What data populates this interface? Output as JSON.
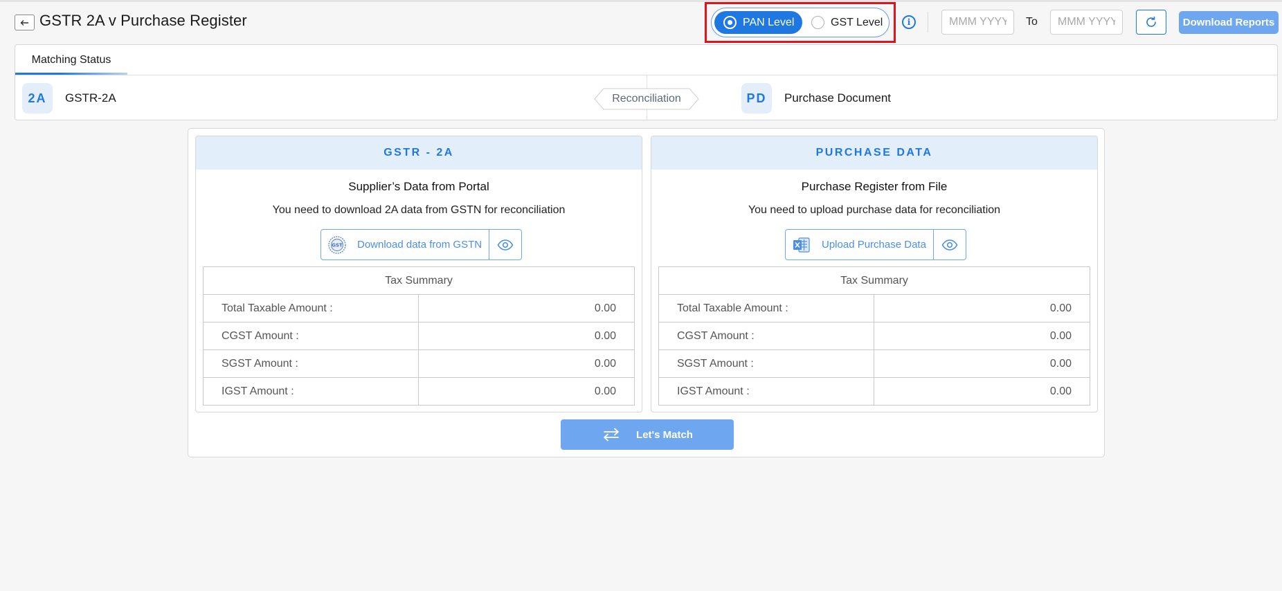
{
  "header": {
    "title": "GSTR 2A v Purchase Register",
    "level_options": [
      {
        "label": "PAN Level",
        "selected": true
      },
      {
        "label": "GST Level",
        "selected": false
      }
    ],
    "from_placeholder": "MMM YYYY",
    "to_label": "To",
    "to_placeholder": "MMM YYYY",
    "download_reports_label": "Download Reports"
  },
  "status": {
    "tab_label": "Matching Status",
    "left_badge": "2A",
    "left_label": "GSTR-2A",
    "center_label": "Reconciliation",
    "right_badge": "PD",
    "right_label": "Purchase Document"
  },
  "panels": [
    {
      "heading": "GSTR - 2A",
      "title": "Supplier’s Data from Portal",
      "description": "You need to download 2A data from GSTN for reconciliation",
      "action_label": "Download data from GSTN",
      "action_icon": "gst-seal-icon",
      "summary": {
        "heading": "Tax Summary",
        "rows": [
          {
            "label": "Total Taxable Amount :",
            "value": "0.00"
          },
          {
            "label": "CGST Amount :",
            "value": "0.00"
          },
          {
            "label": "SGST Amount :",
            "value": "0.00"
          },
          {
            "label": "IGST Amount :",
            "value": "0.00"
          }
        ]
      }
    },
    {
      "heading": "PURCHASE DATA",
      "title": "Purchase Register from File",
      "description": "You need to upload purchase data for reconciliation",
      "action_label": "Upload Purchase Data",
      "action_icon": "excel-file-icon",
      "summary": {
        "heading": "Tax Summary",
        "rows": [
          {
            "label": "Total Taxable Amount :",
            "value": "0.00"
          },
          {
            "label": "CGST Amount :",
            "value": "0.00"
          },
          {
            "label": "SGST Amount :",
            "value": "0.00"
          },
          {
            "label": "IGST Amount :",
            "value": "0.00"
          }
        ]
      }
    }
  ],
  "match_button_label": "Let's Match",
  "colors": {
    "accent": "#1f78e0",
    "accent_light": "#6ea7ef",
    "header_tint": "#e3eefb",
    "highlight": "#e0141e"
  }
}
